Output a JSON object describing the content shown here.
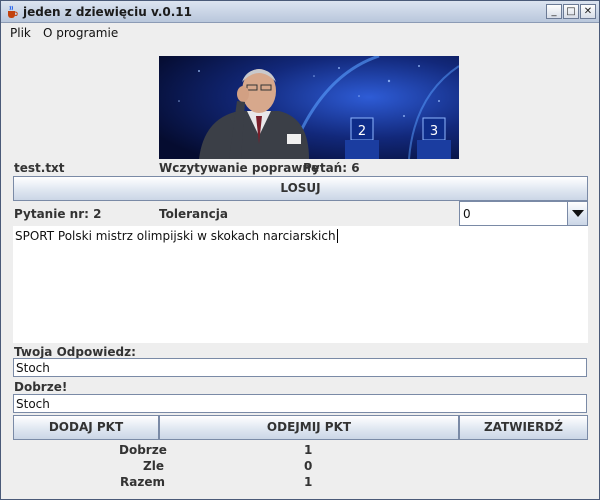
{
  "window": {
    "title": "jeden z dziewięciu v.0.11",
    "minimize": "_",
    "maximize": "□",
    "close": "✕"
  },
  "menu": {
    "file": "Plik",
    "about": "O programie"
  },
  "status": {
    "file_name": "test.txt",
    "load_status": "Wczytywanie poprawne",
    "questions_count_label": "Pytań: 6"
  },
  "buttons": {
    "draw": "LOSUJ",
    "add_point": "DODAJ PKT",
    "subtract_point": "ODEJMIJ PKT",
    "confirm": "ZATWIERDŹ"
  },
  "question": {
    "number_label": "Pytanie nr: 2",
    "tolerance_label": "Tolerancja",
    "tolerance_value": "0",
    "text": "SPORT Polski mistrz olimpijski w skokach narciarskich"
  },
  "answer": {
    "your_answer_label": "Twoja Odpowiedz:",
    "your_answer_value": "Stoch",
    "verdict_label": "Dobrze!",
    "correct_answer_value": "Stoch"
  },
  "score": {
    "correct_label": "Dobrze",
    "correct_value": "1",
    "wrong_label": "Zle",
    "wrong_value": "0",
    "total_label": "Razem",
    "total_value": "1"
  },
  "icons": {
    "app": "java-cup-icon",
    "dropdown": "chevron-down-icon"
  },
  "colors": {
    "window_bg": "#eeeeee",
    "titlebar": "#c8d3e5",
    "button_border": "#7a8aa6",
    "banner_bg": "#0b1a55"
  }
}
